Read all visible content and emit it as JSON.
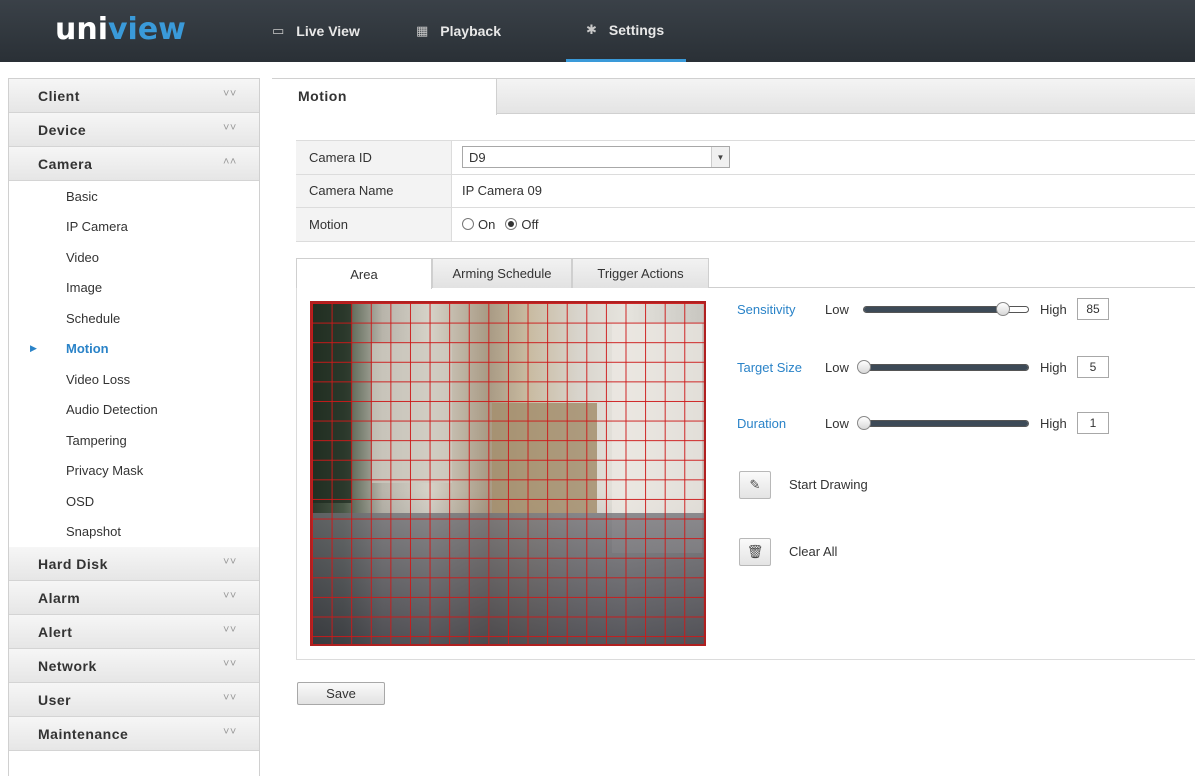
{
  "brand": {
    "logo_part1": "uni",
    "logo_part2": "view"
  },
  "topnav": {
    "tabs": [
      {
        "label": "Live View",
        "icon": "monitor-icon"
      },
      {
        "label": "Playback",
        "icon": "film-icon"
      },
      {
        "label": "Settings",
        "icon": "gear-icon",
        "active": true
      }
    ]
  },
  "sidebar": {
    "sections": [
      {
        "label": "Client"
      },
      {
        "label": "Device"
      },
      {
        "label": "Camera",
        "expanded": true,
        "items": [
          "Basic",
          "IP Camera",
          "Video",
          "Image",
          "Schedule",
          "Motion",
          "Video Loss",
          "Audio Detection",
          "Tampering",
          "Privacy Mask",
          "OSD",
          "Snapshot"
        ],
        "active_item": "Motion"
      },
      {
        "label": "Hard Disk"
      },
      {
        "label": "Alarm"
      },
      {
        "label": "Alert"
      },
      {
        "label": "Network"
      },
      {
        "label": "User"
      },
      {
        "label": "Maintenance"
      }
    ]
  },
  "page": {
    "tab": "Motion"
  },
  "form": {
    "camera_id_label": "Camera ID",
    "camera_id_value": "D9",
    "camera_name_label": "Camera Name",
    "camera_name_value": "IP Camera 09",
    "motion_label": "Motion",
    "motion_on": "On",
    "motion_off": "Off",
    "motion_selected": "Off"
  },
  "subtabs": [
    "Area",
    "Arming Schedule",
    "Trigger Actions"
  ],
  "sliders": {
    "sensitivity": {
      "label": "Sensitivity",
      "low": "Low",
      "high": "High",
      "value": "85",
      "fraction": 0.85
    },
    "target_size": {
      "label": "Target Size",
      "low": "Low",
      "high": "High",
      "value": "5",
      "fraction": 0.0
    },
    "duration": {
      "label": "Duration",
      "low": "Low",
      "high": "High",
      "value": "1",
      "fraction": 0.0
    }
  },
  "actions": {
    "start_drawing": "Start Drawing",
    "clear_all": "Clear All"
  },
  "save_label": "Save",
  "colors": {
    "accent": "#2a83c8",
    "grid": "#cc1a1a",
    "topbar": "#30363c"
  }
}
